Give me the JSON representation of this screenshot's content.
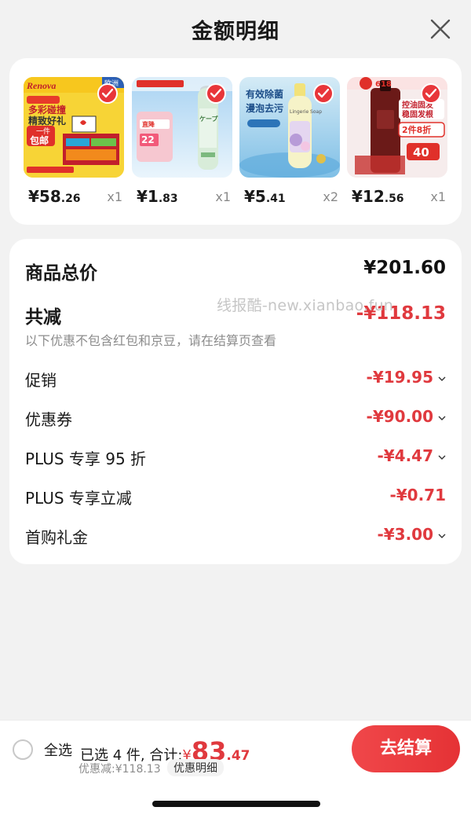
{
  "header": {
    "title": "金额明细",
    "close_icon": "close-icon"
  },
  "products": [
    {
      "price_int": "¥58",
      "price_dec": ".26",
      "qty": "x1",
      "thumb": "renova",
      "thumb_texts": [
        "Renova",
        "欧洲",
        "多彩碰撞",
        "精致好礼",
        "一件",
        "包邮"
      ]
    },
    {
      "price_int": "¥1",
      "price_dec": ".83",
      "qty": "x1",
      "thumb": "spray",
      "thumb_texts": [
        "直降",
        "22",
        "ケープ"
      ]
    },
    {
      "price_int": "¥5",
      "price_dec": ".41",
      "qty": "x2",
      "thumb": "lingerie",
      "thumb_texts": [
        "有效除菌",
        "漫泡去污",
        "Lingerie Soap"
      ]
    },
    {
      "price_int": "¥12",
      "price_dec": ".56",
      "qty": "x1",
      "thumb": "shampoo",
      "thumb_texts": [
        "618",
        "控油固发",
        "稳固发根",
        "2件8折",
        "40"
      ]
    }
  ],
  "summary": {
    "total_label": "商品总价",
    "total_value": "¥201.60",
    "reduce_label": "共减",
    "reduce_value": "-¥118.13",
    "note": "以下优惠不包含红包和京豆，请在结算页查看",
    "items": [
      {
        "label": "促销",
        "value": "-¥19.95"
      },
      {
        "label": "优惠券",
        "value": "-¥90.00"
      },
      {
        "label": "PLUS 专享 95 折",
        "value": "-¥4.47"
      },
      {
        "label": "PLUS 专享立减",
        "value": "-¥0.71"
      },
      {
        "label": "首购礼金",
        "value": "-¥3.00"
      }
    ]
  },
  "watermark": "线报酷-new.xianbao.fun",
  "bottom": {
    "select_all": "全选",
    "selected_prefix": "已选 4 件, 合计:",
    "yen": "¥",
    "total_int": "83",
    "total_dec": ".47",
    "discount": "优惠减:¥118.13",
    "detail": "优惠明细",
    "checkout": "去结算"
  },
  "colors": {
    "accent": "#e0393e",
    "background": "#f2f2f2"
  }
}
